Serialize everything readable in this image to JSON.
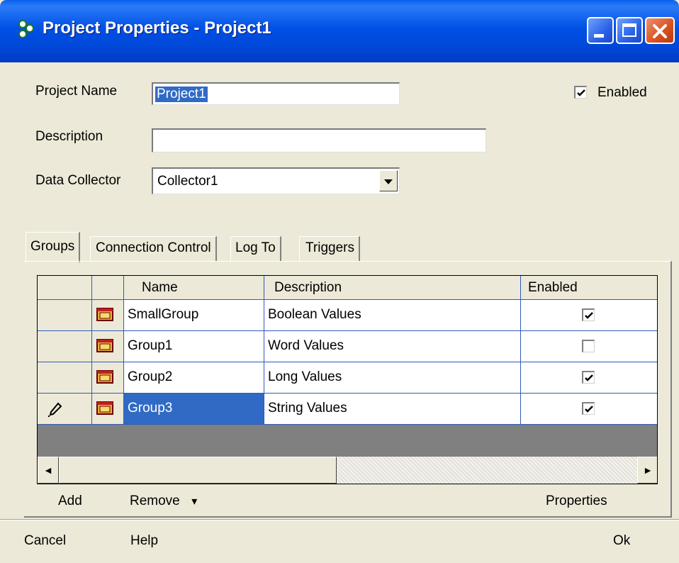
{
  "window": {
    "title": "Project Properties - Project1"
  },
  "form": {
    "project_name_label": "Project Name",
    "project_name_value": "Project1",
    "description_label": "Description",
    "description_value": "",
    "data_collector_label": "Data Collector",
    "data_collector_value": "Collector1",
    "enabled_label": "Enabled",
    "enabled_checked": true
  },
  "tabs": [
    {
      "label": "Groups",
      "active": true
    },
    {
      "label": "Connection Control",
      "active": false
    },
    {
      "label": "Log To",
      "active": false
    },
    {
      "label": "Triggers",
      "active": false
    }
  ],
  "grid": {
    "columns": [
      "Name",
      "Description",
      "Enabled"
    ],
    "rows": [
      {
        "indicator": "",
        "name": "SmallGroup",
        "description": "Boolean Values",
        "enabled": true,
        "selected": false
      },
      {
        "indicator": "",
        "name": "Group1",
        "description": "Word Values",
        "enabled": false,
        "selected": false
      },
      {
        "indicator": "",
        "name": "Group2",
        "description": "Long Values",
        "enabled": true,
        "selected": false
      },
      {
        "indicator": "pencil",
        "name": "Group3",
        "description": "String Values",
        "enabled": true,
        "selected": true
      }
    ],
    "row_icon": "folder-icon",
    "scroll_left_glyph": "◄",
    "scroll_right_glyph": "►"
  },
  "group_actions": {
    "add": "Add",
    "remove": "Remove",
    "remove_arrow": "▾",
    "properties": "Properties"
  },
  "footer": {
    "cancel": "Cancel",
    "help": "Help",
    "ok": "Ok"
  },
  "colors": {
    "titlebar": "#0054E3",
    "selection": "#316AC5",
    "face": "#ECE9D8",
    "grid_line": "#2E5CB8"
  }
}
